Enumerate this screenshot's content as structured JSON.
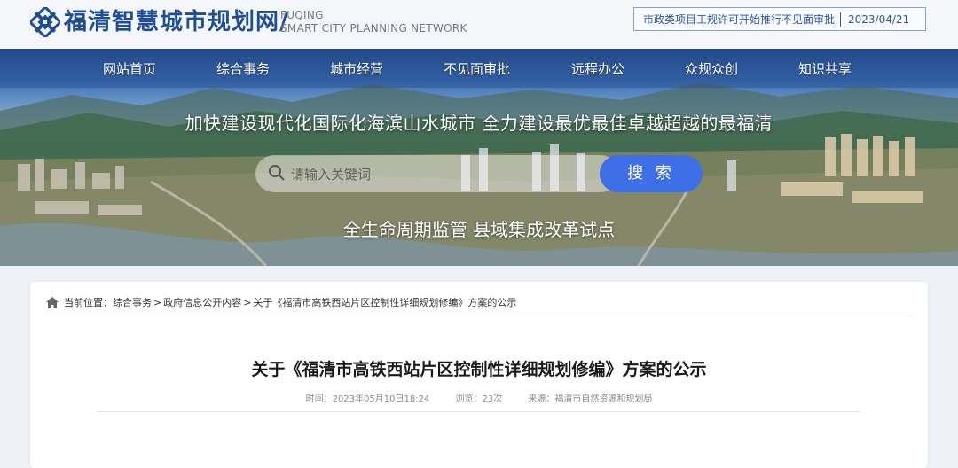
{
  "header": {
    "site_name": "福清智慧城市规划网/",
    "site_en_line1": "FUQING",
    "site_en_line2": "SMART CITY PLANNING NETWORK",
    "notice_text": "市政类项目工规许可开始推行不见面审批",
    "notice_date": "2023/04/21"
  },
  "nav": {
    "items": [
      "网站首页",
      "综合事务",
      "城市经营",
      "不见面审批",
      "远程办公",
      "众规众创",
      "知识共享"
    ]
  },
  "banner": {
    "slogan": "加快建设现代化国际化海滨山水城市 全力建设最优最佳卓越超越的最福清",
    "slogan2": "全生命周期监管  县域集成改革试点",
    "search_placeholder": "请输入关键词",
    "search_button": "搜 索"
  },
  "breadcrumb": {
    "label": "当前位置：",
    "items": [
      "综合事务",
      "政府信息公开内容",
      "关于《福清市高铁西站片区控制性详细规划修编》方案的公示"
    ],
    "separator": ">"
  },
  "article": {
    "title": "关于《福清市高铁西站片区控制性详细规划修编》方案的公示",
    "time": "时间：2023年05月10日18:24",
    "views": "浏览：23次",
    "source": "来源：福清市自然资源和规划局"
  },
  "colors": {
    "brand_blue": "#1f4e96",
    "search_button": "#3f6fe6",
    "notice_border": "#7fa0d8"
  }
}
